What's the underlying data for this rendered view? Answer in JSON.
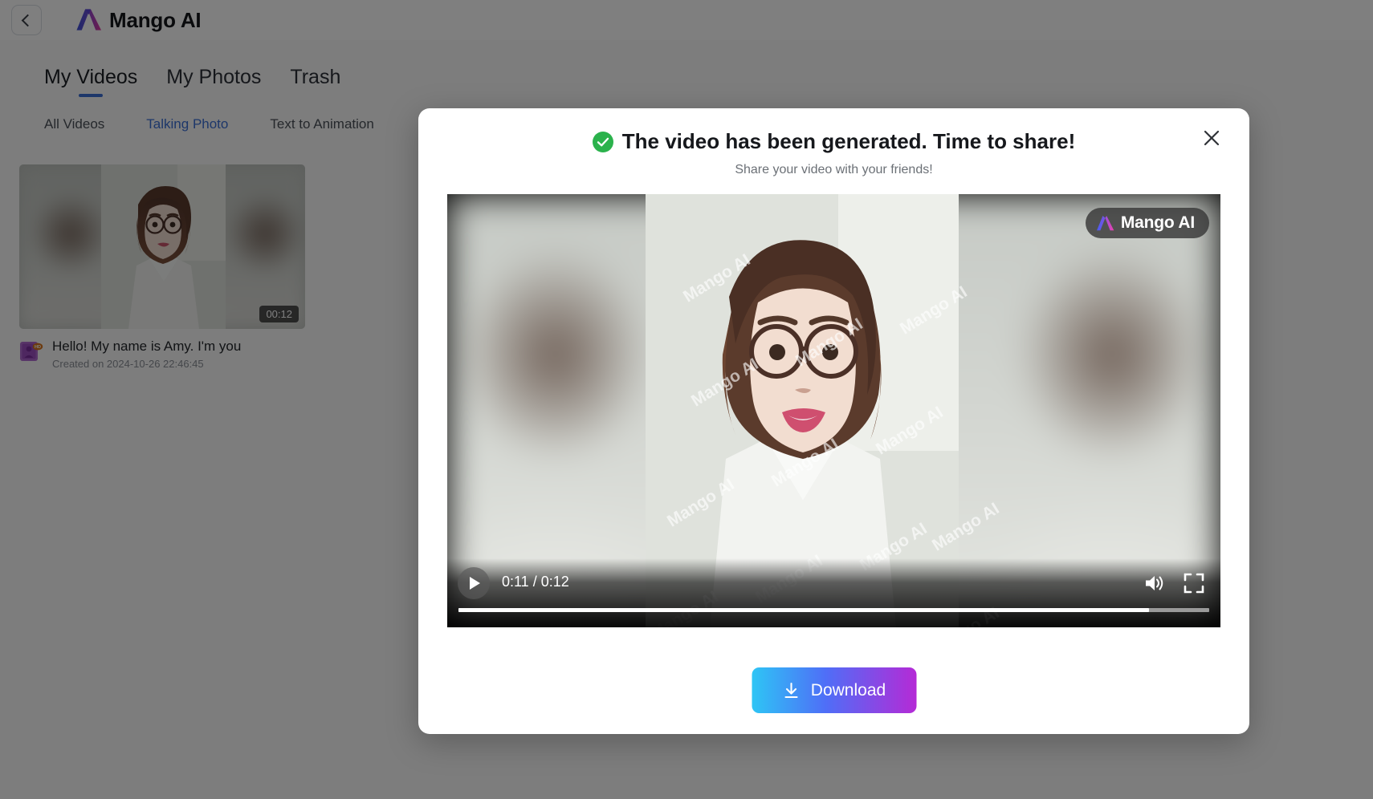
{
  "app": {
    "brand_name": "Mango AI",
    "back_icon": "chevron-left-icon",
    "logo_icon": "mango-ai-logo-icon"
  },
  "nav": {
    "main_tabs": [
      {
        "label": "My Videos",
        "active": true
      },
      {
        "label": "My Photos",
        "active": false
      },
      {
        "label": "Trash",
        "active": false
      }
    ],
    "sub_tabs": [
      {
        "label": "All Videos",
        "active": false
      },
      {
        "label": "Talking Photo",
        "active": true
      },
      {
        "label": "Text to Animation",
        "active": false
      }
    ]
  },
  "library": {
    "cards": [
      {
        "title": "Hello! My name is Amy. I'm you",
        "created": "Created on 2024-10-26 22:46:45",
        "duration": "00:12",
        "badge_icon": "talking-photo-hd-icon"
      }
    ]
  },
  "modal": {
    "status_icon": "success-check-icon",
    "title": "The video has been generated. Time to share!",
    "subtitle": "Share your video with your friends!",
    "close_icon": "close-icon",
    "download_label": "Download",
    "download_icon": "download-icon",
    "download_gradient": [
      "#2ec5f5",
      "#4f6ef7",
      "#b52ad6"
    ]
  },
  "player": {
    "play_icon": "play-icon",
    "time_display": "0:11 / 0:12",
    "current_time": "0:11",
    "duration": "0:12",
    "progress_percent": 92,
    "volume_icon": "volume-on-icon",
    "fullscreen_icon": "fullscreen-icon",
    "watermark_text": "Mango AI",
    "watermark_badge": "Mango AI"
  },
  "colors": {
    "accent_blue": "#3b6fd4",
    "success_green": "#2bb24c",
    "overlay": "rgba(0,0,0,0.50)"
  }
}
